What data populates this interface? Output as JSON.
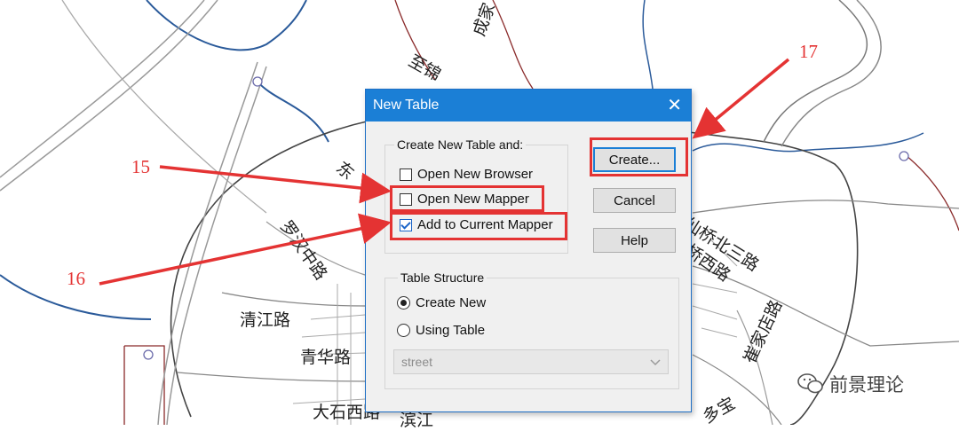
{
  "map_labels": [
    {
      "name": "map-label-chengjiao",
      "text": "成家"
    },
    {
      "name": "map-label-zhimian",
      "text": "至锦"
    },
    {
      "name": "map-label-dong",
      "text": "东"
    },
    {
      "name": "map-label-luohan",
      "text": "罗汉中路"
    },
    {
      "name": "map-label-qingjiang",
      "text": "清江路"
    },
    {
      "name": "map-label-qinghua",
      "text": "青华路"
    },
    {
      "name": "map-label-dashixi",
      "text": "大石西路"
    },
    {
      "name": "map-label-bin",
      "text": "滨江"
    },
    {
      "name": "map-label-xianqiao",
      "text": "仙桥北三路"
    },
    {
      "name": "map-label-qiaoxi",
      "text": "桥西路"
    },
    {
      "name": "map-label-cuijia",
      "text": "崔家店路"
    },
    {
      "name": "map-label-duobao",
      "text": "多宝"
    }
  ],
  "annotations": {
    "a15": "15",
    "a16": "16",
    "a17": "17"
  },
  "dialog": {
    "title": "New Table",
    "close_glyph": "✕",
    "create_group": {
      "label": "Create New Table and:",
      "options": [
        {
          "label": "Open New Browser",
          "checked": false
        },
        {
          "label": "Open New Mapper",
          "checked": false
        },
        {
          "label": "Add to Current Mapper",
          "checked": true
        }
      ]
    },
    "buttons": {
      "create": "Create...",
      "cancel": "Cancel",
      "help": "Help"
    },
    "structure_group": {
      "label": "Table Structure",
      "options": [
        {
          "label": "Create New",
          "selected": true
        },
        {
          "label": "Using Table",
          "selected": false
        }
      ],
      "table_select": "street"
    }
  },
  "watermark": "前景理论",
  "colors": {
    "highlight": "#e43333",
    "titlebar": "#1b7fd6"
  }
}
